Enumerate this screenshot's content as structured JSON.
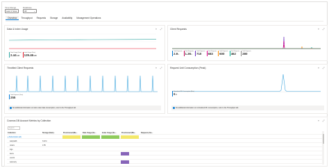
{
  "filters": {
    "time_range": {
      "label": "Time Range",
      "value": "Last 1 hour"
    },
    "database": {
      "label": "Database",
      "value": "All"
    }
  },
  "tabs": [
    {
      "label": "Overview",
      "active": true
    },
    {
      "label": "Throughput",
      "active": false
    },
    {
      "label": "Requests",
      "active": false
    },
    {
      "label": "Storage",
      "active": false
    },
    {
      "label": "Availability",
      "active": false
    },
    {
      "label": "Management Operations",
      "active": false
    }
  ],
  "cards": {
    "data_index": {
      "title": "Data & Index Usage",
      "legend": [
        {
          "name": "Data Usage (Sum)",
          "value": "2.44",
          "unit": "GiB"
        },
        {
          "name": "Index Usage (Sum)",
          "value": "129.46",
          "unit": "MiB"
        }
      ]
    },
    "client_requests": {
      "title": "Client Requests",
      "legend": [
        {
          "name": "Total Requests",
          "value": "2.9",
          "unit": "k"
        },
        {
          "name": "Total Requests",
          "value": "1.36",
          "unit": "k"
        },
        {
          "name": "Total Requests",
          "value": "710",
          "unit": ""
        },
        {
          "name": "Total Requests",
          "value": "683",
          "unit": ""
        },
        {
          "name": "Total Requests",
          "value": "600",
          "unit": ""
        },
        {
          "name": "Total Requests",
          "value": "462",
          "unit": ""
        },
        {
          "name": "Total Requests",
          "value": "280",
          "unit": ""
        }
      ]
    },
    "throttled": {
      "title": "Throttled Client Requests",
      "legend": [
        {
          "name": "Total Requests (Sum)",
          "value": "255",
          "unit": ""
        }
      ],
      "info": "No additional information on ratio under data consumption, refer to the Throughput tab."
    },
    "ru_consumption": {
      "title": "Request Unit Consumption (Peak)",
      "legend": [
        {
          "name": "Normalized RU Consumption (Max)",
          "value": "6",
          "unit": "%"
        }
      ],
      "info": "No additional information on normalized RU consumption, refer to the Throughput tab."
    }
  },
  "table": {
    "title": "Cosmos DB Account Metrics by Collection",
    "filter_placeholder": "Search",
    "columns": [
      "Collection",
      "Storage (Sum) ↓",
      "Provisioned (Ma...",
      "Data Usage (Su...",
      "Index Usage (Su...",
      "Provisioned (Ma...",
      "Requests (Su..."
    ],
    "rows": [
      {
        "name": "▸ Subscription (all)",
        "c1": "",
        "c2": "",
        "c3": "",
        "c4": "",
        "c5": "",
        "c6": ""
      },
      {
        "name": "sampledb",
        "c1": "3.22 k",
        "c2": "",
        "c3": "",
        "c4": "",
        "c5": "",
        "c6": ""
      },
      {
        "name": "orders",
        "c1": "1.55",
        "c2": "",
        "c3": "",
        "c4": "",
        "c5": "",
        "c6": ""
      },
      {
        "name": "logs",
        "c1": "",
        "c2": "",
        "c3": "",
        "c4": "",
        "c5": "",
        "c6": ""
      },
      {
        "name": "items",
        "c1": "",
        "c2": "",
        "c3": "",
        "c4": "",
        "c5": "",
        "c6": ""
      },
      {
        "name": "events",
        "c1": "",
        "c2": "",
        "c3": "",
        "c4": "",
        "c5": "",
        "c6": ""
      },
      {
        "name": "telemetry",
        "c1": "",
        "c2": "",
        "c3": "",
        "c4": "",
        "c5": "",
        "c6": ""
      }
    ],
    "bar_colors": {
      "yellow": "#f3e86a",
      "green": "#8fcb5c",
      "purple": "#8764b8"
    }
  },
  "colors": {
    "accent": "#0078d4",
    "red_line": "#e81123",
    "teal_line": "#2da5a0",
    "series_blue": "#3fa6de"
  }
}
